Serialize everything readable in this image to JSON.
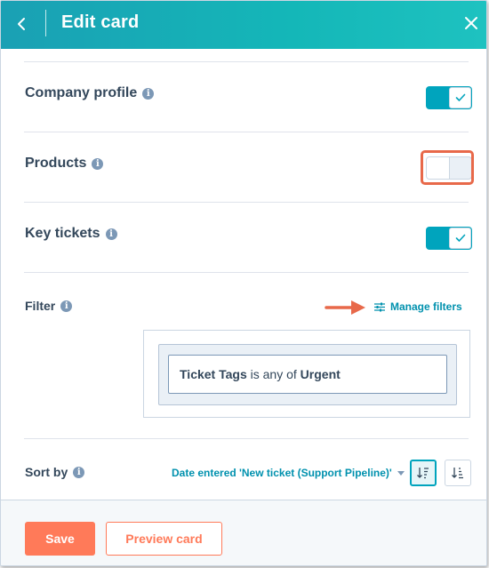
{
  "header": {
    "title": "Edit card",
    "back_icon": "chevron-left-icon",
    "close_icon": "close-icon",
    "gradient_colors": [
      "#1aa0b4",
      "#1ec2c0"
    ]
  },
  "sections": [
    {
      "label": "Company profile",
      "info_icon": "i",
      "toggle_state": "on"
    },
    {
      "label": "Products",
      "info_icon": "i",
      "toggle_state": "off",
      "highlighted": true
    },
    {
      "label": "Key tickets",
      "info_icon": "i",
      "toggle_state": "on"
    }
  ],
  "filter": {
    "label": "Filter",
    "info_icon": "i",
    "manage_label": "Manage filters",
    "manage_icon": "sliders-icon",
    "rule": {
      "property": "Ticket Tags",
      "operator": " is any of ",
      "value": "Urgent"
    }
  },
  "sort": {
    "label": "Sort by",
    "info_icon": "i",
    "selected": "Date entered 'New ticket (Support Pipeline)'",
    "descending_icon": "sort-descending-icon",
    "ascending_icon": "sort-ascending-icon",
    "active_direction": "descending"
  },
  "footer": {
    "save_label": "Save",
    "preview_label": "Preview card"
  },
  "colors": {
    "accent": "#00a4bd",
    "primary_button": "#ff7a59",
    "annotation": "#e8694a",
    "text": "#33475b",
    "link": "#0091ae"
  }
}
